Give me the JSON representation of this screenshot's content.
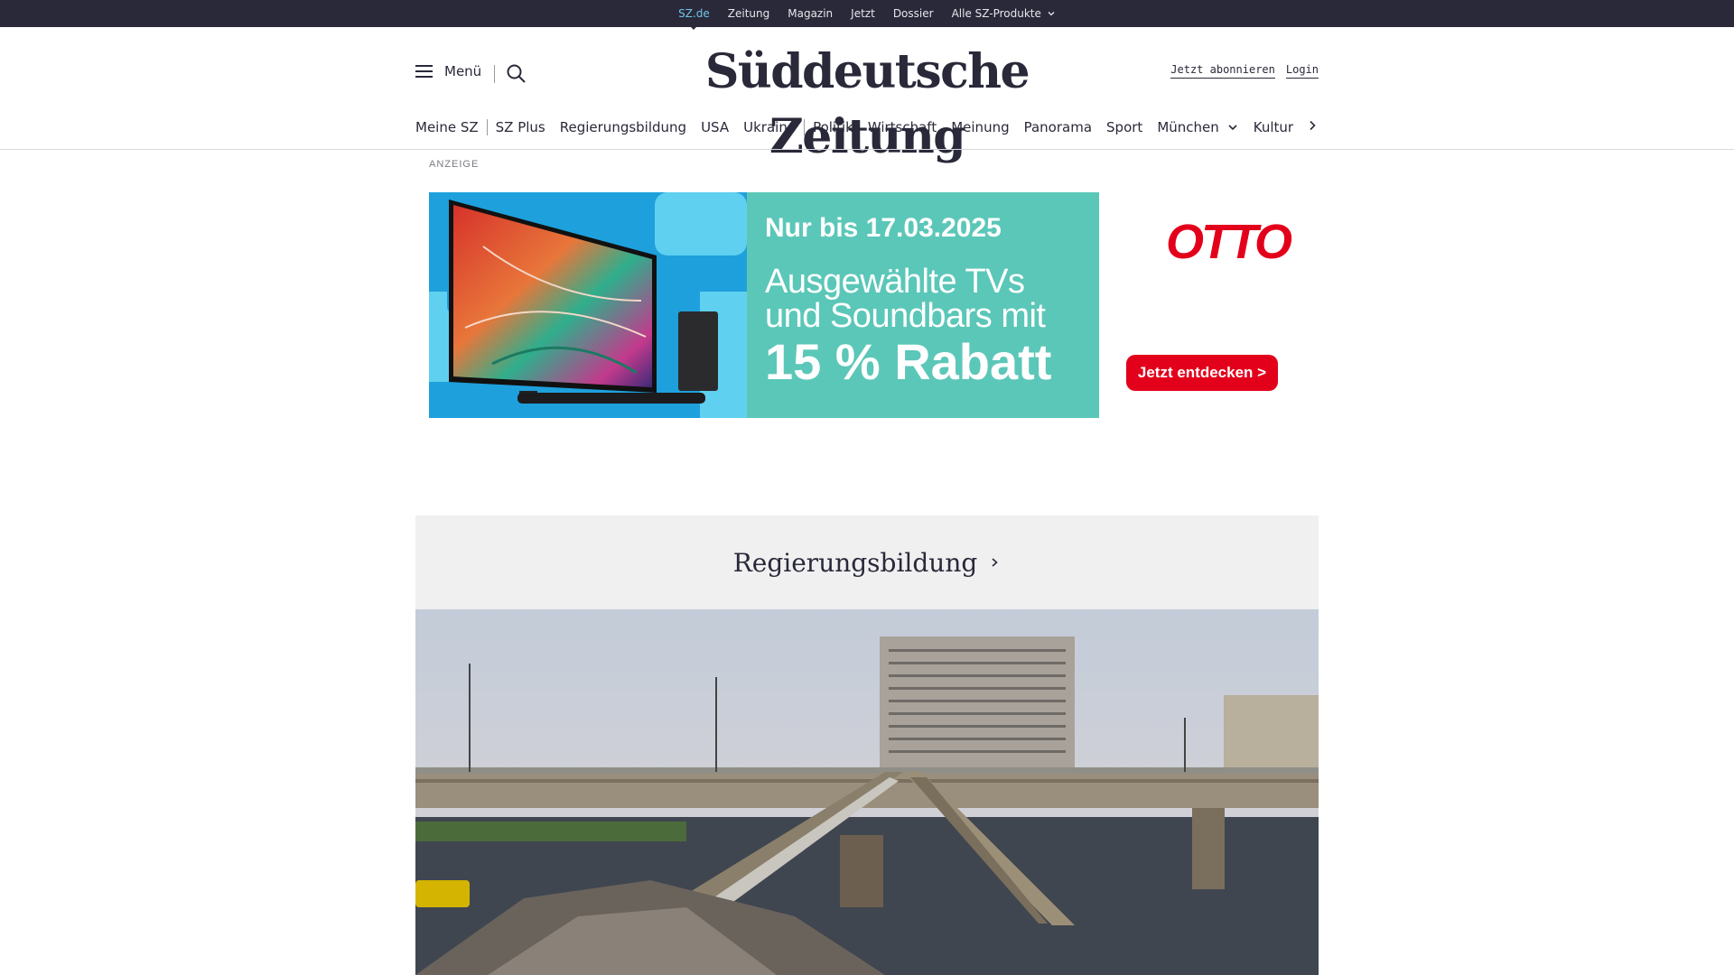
{
  "topbar": {
    "links": [
      "SZ.de",
      "Zeitung",
      "Magazin",
      "Jetzt",
      "Dossier",
      "Alle SZ-Produkte"
    ],
    "active": "SZ.de"
  },
  "header": {
    "menu_label": "Menü",
    "logo_text": "Süddeutsche Zeitung",
    "subscribe_label": "Jetzt abonnieren",
    "login_label": "Login"
  },
  "nav": {
    "items": [
      "Meine SZ",
      "SZ Plus",
      "Regierungsbildung",
      "USA",
      "Ukraine",
      "Politik",
      "Wirtschaft",
      "Meinung",
      "Panorama",
      "Sport",
      "München",
      "Kultur"
    ]
  },
  "ad": {
    "label": "ANZEIGE",
    "date_text": "Nur bis 17.03.2025",
    "line1": "Ausgewählte TVs",
    "line2": "und Soundbars mit",
    "discount": "15 % Rabatt",
    "brand": "OTTO",
    "cta": "Jetzt entdecken >"
  },
  "section": {
    "title": "Regierungsbildung"
  },
  "colors": {
    "topbar": "#29293a",
    "active_link": "#71c5e8",
    "ad_teal": "#5bc7b8",
    "otto_red": "#e3001b",
    "section_bg": "#f0f0f1"
  },
  "icons": [
    "hamburger-icon",
    "search-icon",
    "chevron-down-icon",
    "chevron-right-icon"
  ]
}
